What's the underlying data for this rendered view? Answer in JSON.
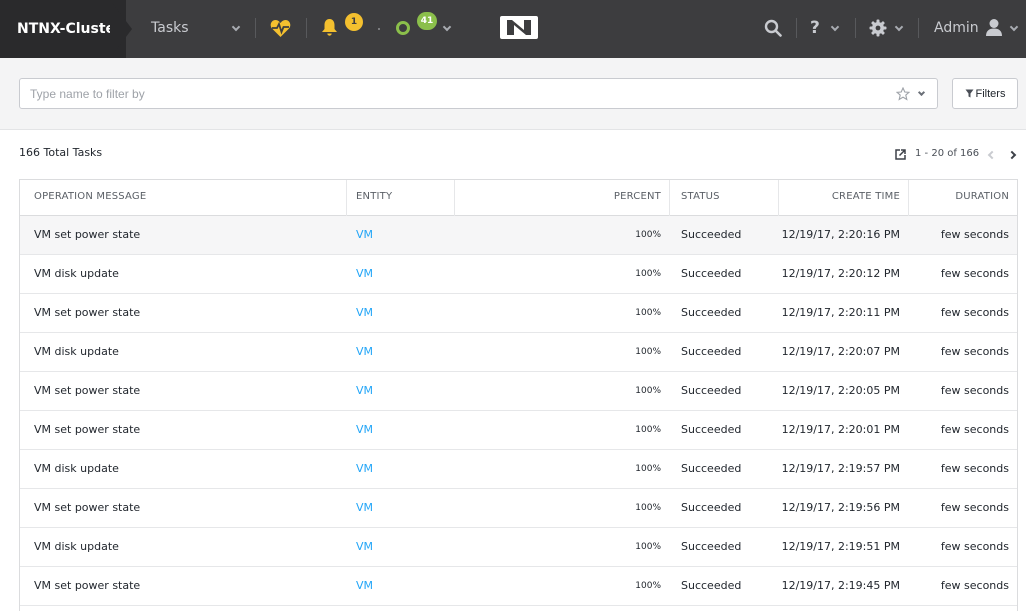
{
  "header": {
    "cluster_name": "NTNX-Cluster",
    "page_title": "Tasks",
    "alerts_count": "1",
    "tasks_count": "41",
    "user_name": "Admin"
  },
  "filter": {
    "placeholder": "Type name to filter by",
    "filters_label": "Filters"
  },
  "summary": {
    "total_label": "166 Total Tasks",
    "range_label": "1 - 20 of 166"
  },
  "table": {
    "columns": [
      "OPERATION MESSAGE",
      "ENTITY",
      "PERCENT",
      "STATUS",
      "CREATE TIME",
      "DURATION"
    ],
    "rows": [
      {
        "operation": "VM set power state",
        "entity": "VM",
        "percent": "100%",
        "status": "Succeeded",
        "create_time": "12/19/17, 2:20:16 PM",
        "duration": "few seconds"
      },
      {
        "operation": "VM disk update",
        "entity": "VM",
        "percent": "100%",
        "status": "Succeeded",
        "create_time": "12/19/17, 2:20:12 PM",
        "duration": "few seconds"
      },
      {
        "operation": "VM set power state",
        "entity": "VM",
        "percent": "100%",
        "status": "Succeeded",
        "create_time": "12/19/17, 2:20:11 PM",
        "duration": "few seconds"
      },
      {
        "operation": "VM disk update",
        "entity": "VM",
        "percent": "100%",
        "status": "Succeeded",
        "create_time": "12/19/17, 2:20:07 PM",
        "duration": "few seconds"
      },
      {
        "operation": "VM set power state",
        "entity": "VM",
        "percent": "100%",
        "status": "Succeeded",
        "create_time": "12/19/17, 2:20:05 PM",
        "duration": "few seconds"
      },
      {
        "operation": "VM set power state",
        "entity": "VM",
        "percent": "100%",
        "status": "Succeeded",
        "create_time": "12/19/17, 2:20:01 PM",
        "duration": "few seconds"
      },
      {
        "operation": "VM disk update",
        "entity": "VM",
        "percent": "100%",
        "status": "Succeeded",
        "create_time": "12/19/17, 2:19:57 PM",
        "duration": "few seconds"
      },
      {
        "operation": "VM set power state",
        "entity": "VM",
        "percent": "100%",
        "status": "Succeeded",
        "create_time": "12/19/17, 2:19:56 PM",
        "duration": "few seconds"
      },
      {
        "operation": "VM disk update",
        "entity": "VM",
        "percent": "100%",
        "status": "Succeeded",
        "create_time": "12/19/17, 2:19:51 PM",
        "duration": "few seconds"
      },
      {
        "operation": "VM set power state",
        "entity": "VM",
        "percent": "100%",
        "status": "Succeeded",
        "create_time": "12/19/17, 2:19:45 PM",
        "duration": "few seconds"
      }
    ]
  },
  "icons": {
    "health": "heartbeat-icon",
    "alerts": "bell-icon",
    "tasks": "circle-icon",
    "logo": "nutanix-logo",
    "search": "search-icon",
    "help": "question-icon",
    "settings": "gear-icon",
    "user": "user-icon",
    "favorite": "star-icon",
    "filter": "funnel-icon",
    "export": "external-link-icon",
    "prev": "chevron-left-icon",
    "next": "chevron-right-icon"
  },
  "colors": {
    "topbar": "#3d3d3f",
    "cluster_bg": "#2a2a2c",
    "accent_yellow": "#f4c02f",
    "accent_green": "#8bbf4b",
    "link": "#22a5f7"
  }
}
